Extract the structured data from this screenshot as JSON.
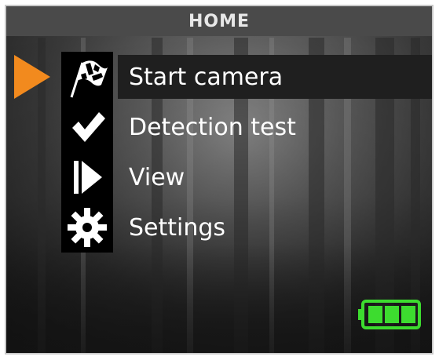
{
  "header": {
    "title": "HOME"
  },
  "menu": {
    "items": [
      {
        "label": "Start camera",
        "icon": "checkered-flag-icon",
        "selected": true
      },
      {
        "label": "Detection test",
        "icon": "checkmark-icon",
        "selected": false
      },
      {
        "label": "View",
        "icon": "play-icon",
        "selected": false
      },
      {
        "label": "Settings",
        "icon": "gear-icon",
        "selected": false
      }
    ]
  },
  "status": {
    "battery_level": 1.0,
    "battery_color": "#3ddc2f"
  },
  "colors": {
    "selector": "#f28a1e",
    "title_bar": "#4a4a4a",
    "menu_text": "#ffffff"
  }
}
